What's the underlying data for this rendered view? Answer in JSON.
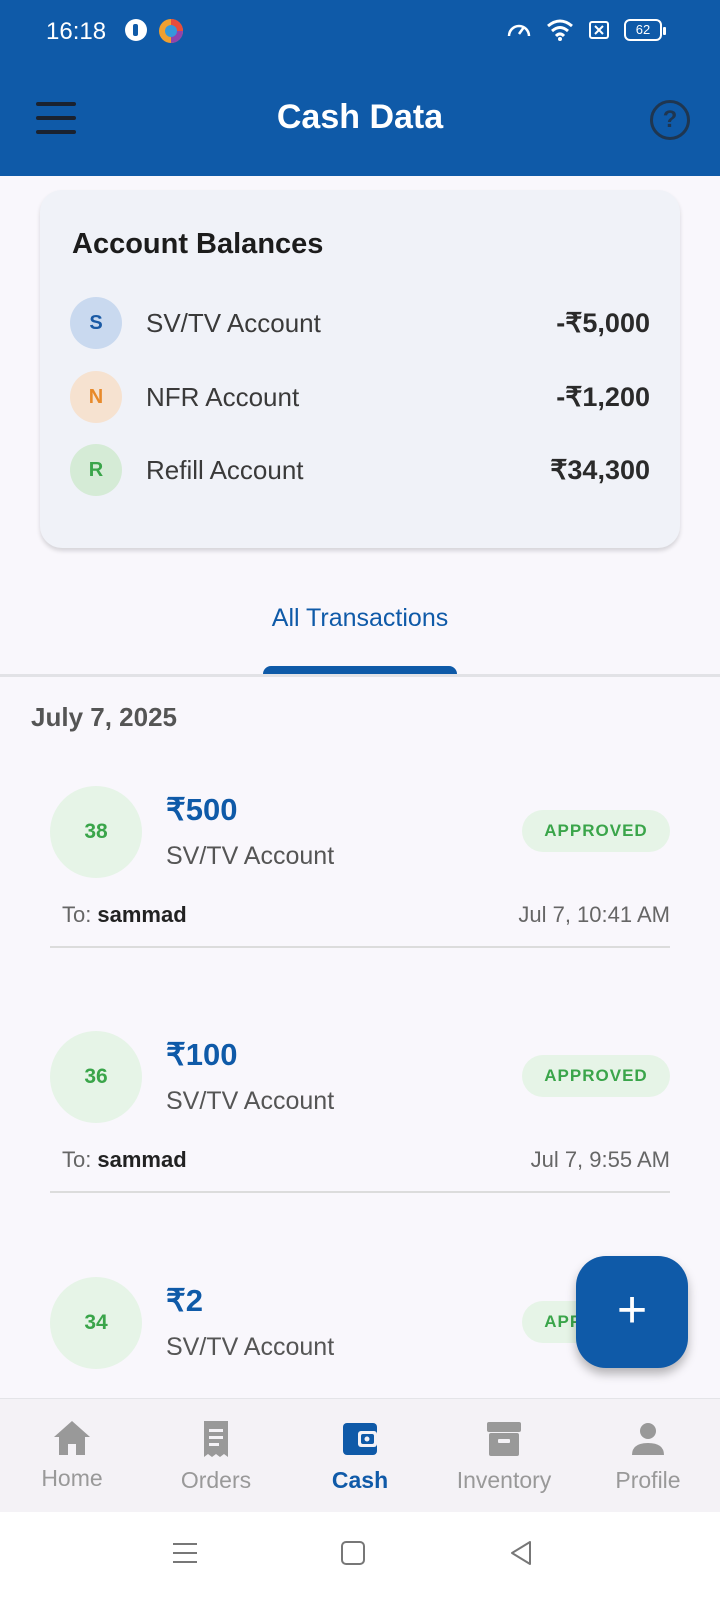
{
  "status_bar": {
    "time": "16:18",
    "battery": "62",
    "icons": [
      "app-notification-icon",
      "browser-icon",
      "speed-icon",
      "wifi-icon",
      "sim-icon",
      "battery-icon"
    ]
  },
  "app_bar": {
    "title": "Cash Data",
    "menu_icon": "menu-icon",
    "help_icon": "help-icon"
  },
  "balances": {
    "title": "Account Balances",
    "accounts": [
      {
        "initial": "S",
        "name": "SV/TV Account",
        "amount": "-₹5,000",
        "bg": "#c9d9ef",
        "fg": "#1a5aa5"
      },
      {
        "initial": "N",
        "name": "NFR Account",
        "amount": "-₹1,200",
        "bg": "#f6e2d0",
        "fg": "#e88a2a"
      },
      {
        "initial": "R",
        "name": "Refill Account",
        "amount": "₹34,300",
        "bg": "#d5ebd6",
        "fg": "#3aa54a"
      }
    ]
  },
  "tabs": {
    "active": "All Transactions"
  },
  "date_header": "July 7, 2025",
  "transactions": [
    {
      "id": "38",
      "amount": "₹500",
      "account": "SV/TV Account",
      "status": "APPROVED",
      "to_label": "To:",
      "to_name": "sammad",
      "time": "Jul 7, 10:41 AM"
    },
    {
      "id": "36",
      "amount": "₹100",
      "account": "SV/TV Account",
      "status": "APPROVED",
      "to_label": "To:",
      "to_name": "sammad",
      "time": "Jul 7, 9:55 AM"
    },
    {
      "id": "34",
      "amount": "₹2",
      "account": "SV/TV Account",
      "status": "APPROVED",
      "to_label": "",
      "to_name": "",
      "time": ""
    }
  ],
  "fab": {
    "label": "+",
    "icon": "add-icon"
  },
  "bottom_nav": [
    {
      "label": "Home",
      "icon": "home-icon",
      "active": false
    },
    {
      "label": "Orders",
      "icon": "receipt-icon",
      "active": false
    },
    {
      "label": "Cash",
      "icon": "wallet-icon",
      "active": true
    },
    {
      "label": "Inventory",
      "icon": "archive-icon",
      "active": false
    },
    {
      "label": "Profile",
      "icon": "person-icon",
      "active": false
    }
  ],
  "colors": {
    "primary": "#0f5aa8",
    "approved_text": "#3aa54a",
    "approved_bg": "#e6f4e7"
  }
}
